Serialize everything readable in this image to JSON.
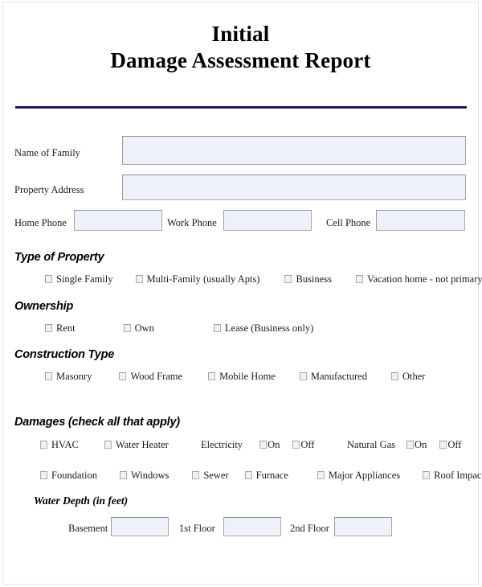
{
  "document": {
    "title_line1": "Initial",
    "title_line2": "Damage Assessment Report",
    "rule_color": "#1b1b6f",
    "field_fill_color": "#eef1fa",
    "field_border_color": "#a8a9ad"
  },
  "identity": {
    "name_of_family": {
      "label": "Name of Family",
      "value": "",
      "placeholder": ""
    },
    "property_address": {
      "label": "Property Address",
      "value": "",
      "placeholder": ""
    },
    "home_phone": {
      "label": "Home Phone",
      "value": "",
      "placeholder": ""
    },
    "work_phone": {
      "label": "Work Phone",
      "value": "",
      "placeholder": ""
    },
    "cell_phone": {
      "label": "Cell Phone",
      "value": "",
      "placeholder": ""
    }
  },
  "sections": {
    "type_of_property": {
      "heading": "Type of Property",
      "options": [
        {
          "label": "Single Family",
          "checked": false
        },
        {
          "label": "Multi-Family (usually Apts)",
          "checked": false
        },
        {
          "label": "Business",
          "checked": false
        },
        {
          "label": "Vacation home - not primary",
          "checked": false
        }
      ]
    },
    "ownership": {
      "heading": "Ownership",
      "options": [
        {
          "label": "Rent",
          "checked": false
        },
        {
          "label": "Own",
          "checked": false
        },
        {
          "label": "Lease (Business only)",
          "checked": false
        }
      ]
    },
    "construction_type": {
      "heading": "Construction Type",
      "options": [
        {
          "label": "Masonry",
          "checked": false
        },
        {
          "label": "Wood Frame",
          "checked": false
        },
        {
          "label": "Mobile Home",
          "checked": false
        },
        {
          "label": "Manufactured",
          "checked": false
        },
        {
          "label": "Other",
          "checked": false
        }
      ]
    },
    "damages": {
      "heading": "Damages (check all that apply)",
      "row1": [
        {
          "label": "HVAC",
          "checked": false
        },
        {
          "label": "Water Heater",
          "checked": false
        }
      ],
      "utilities": [
        {
          "name": "Electricity",
          "options": [
            {
              "label": "On",
              "checked": false
            },
            {
              "label": "Off",
              "checked": false
            }
          ]
        },
        {
          "name": "Natural Gas",
          "options": [
            {
              "label": "On",
              "checked": false
            },
            {
              "label": "Off",
              "checked": false
            }
          ]
        }
      ],
      "row2": [
        {
          "label": "Foundation",
          "checked": false
        },
        {
          "label": "Windows",
          "checked": false
        },
        {
          "label": "Sewer",
          "checked": false
        },
        {
          "label": "Furnace",
          "checked": false
        },
        {
          "label": "Major Appliances",
          "checked": false
        },
        {
          "label": "Roof Impact",
          "checked": false
        }
      ]
    },
    "water_depth": {
      "heading": "Water Depth (in feet)",
      "fields": [
        {
          "label": "Basement",
          "value": "",
          "placeholder": ""
        },
        {
          "label": "1st Floor",
          "value": "",
          "placeholder": ""
        },
        {
          "label": "2nd Floor",
          "value": "",
          "placeholder": ""
        }
      ]
    }
  }
}
